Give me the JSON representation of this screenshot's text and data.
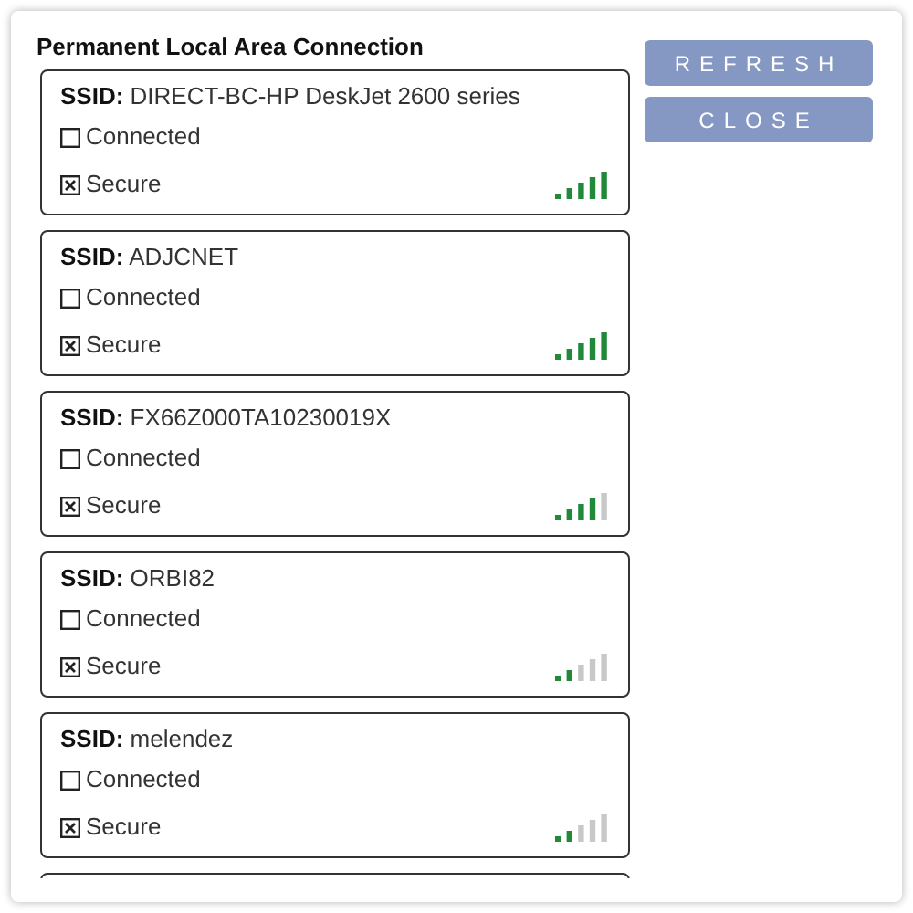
{
  "title": "Permanent Local Area Connection",
  "networks": [
    {
      "ssid_label": "SSID:",
      "ssid": "DIRECT-BC-HP DeskJet 2600 series",
      "connected": {
        "label": "Connected",
        "checked": false
      },
      "secure": {
        "label": "Secure",
        "checked": true
      },
      "level": 1
    },
    {
      "ssid_label": "SSID:",
      "ssid": "ADJCNET",
      "connected": {
        "label": "Connected",
        "checked": false
      },
      "secure": {
        "label": "Secure",
        "checked": true
      },
      "level": 1
    },
    {
      "ssid_label": "SSID:",
      "ssid": "FX66Z000TA10230019X",
      "connected": {
        "label": "Connected",
        "checked": false
      },
      "secure": {
        "label": "Secure",
        "checked": true
      },
      "level": 0.8
    },
    {
      "ssid_label": "SSID:",
      "ssid": "ORBI82",
      "connected": {
        "label": "Connected",
        "checked": false
      },
      "secure": {
        "label": "Secure",
        "checked": true
      },
      "level": 0.4
    },
    {
      "ssid_label": "SSID:",
      "ssid": "melendez",
      "connected": {
        "label": "Connected",
        "checked": false
      },
      "secure": {
        "label": "Secure",
        "checked": true
      },
      "level": 0.4
    }
  ],
  "buttons": [
    "REFRESH",
    "CLOSE"
  ]
}
